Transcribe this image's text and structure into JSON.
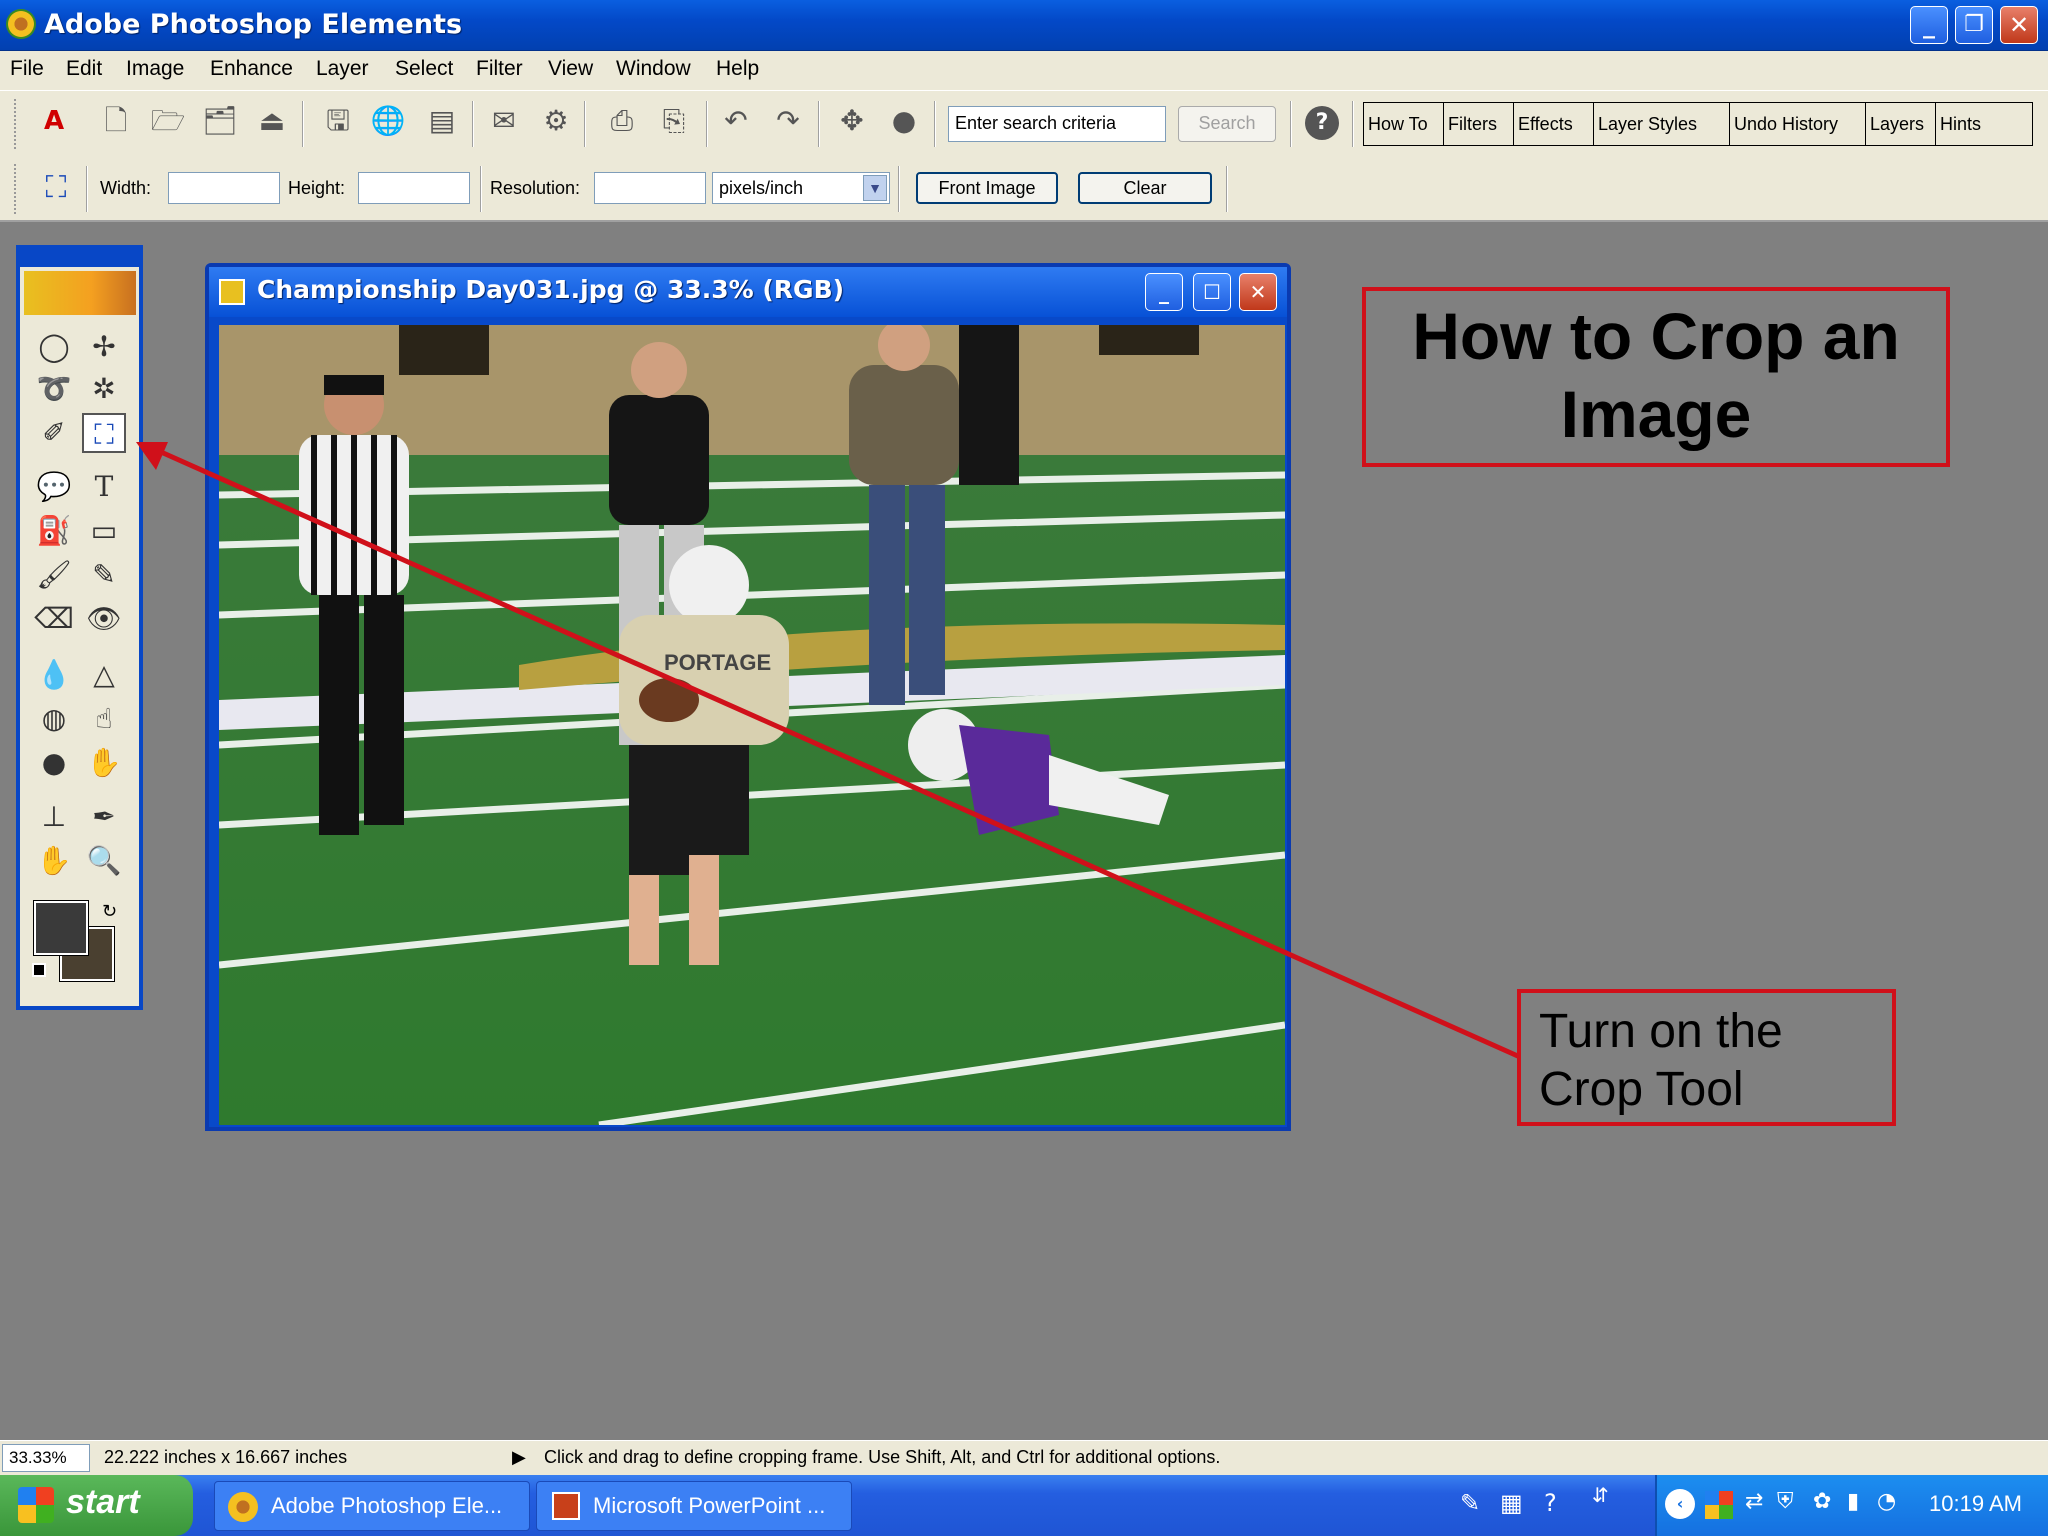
{
  "window": {
    "title": "Adobe Photoshop Elements",
    "minimize": "_",
    "restore": "❐",
    "close": "✕"
  },
  "menu": [
    "File",
    "Edit",
    "Image",
    "Enhance",
    "Layer",
    "Select",
    "Filter",
    "View",
    "Window",
    "Help"
  ],
  "toolbar": {
    "search_value": "Enter search criteria",
    "search_button": "Search",
    "help_icon": "?"
  },
  "palette_tabs": [
    "How To",
    "Filters",
    "Effects",
    "Layer Styles",
    "Undo History",
    "Layers",
    "Hints"
  ],
  "options": {
    "width_label": "Width:",
    "width_value": "",
    "height_label": "Height:",
    "height_value": "",
    "resolution_label": "Resolution:",
    "resolution_value": "",
    "units": "pixels/inch",
    "front_image": "Front Image",
    "clear": "Clear"
  },
  "document": {
    "title": "Championship Day031.jpg @ 33.3% (RGB)",
    "jersey_text": "PORTAGE"
  },
  "callouts": {
    "heading": "How to Crop an Image",
    "note": "Turn on the Crop Tool"
  },
  "status": {
    "zoom": "33.33%",
    "doc_size": "22.222 inches x 16.667 inches",
    "hint": "Click and drag to define cropping frame. Use Shift, Alt, and Ctrl for additional options."
  },
  "taskbar": {
    "start": "start",
    "tasks": [
      "Adobe Photoshop Ele...",
      "Microsoft PowerPoint ..."
    ],
    "clock": "10:19 AM"
  },
  "colors": {
    "callout_border": "#d0101a",
    "arrow": "#d0101a",
    "titlebar": "#0349c8",
    "foreground": "#3a3a3a",
    "background": "#4a4030"
  }
}
